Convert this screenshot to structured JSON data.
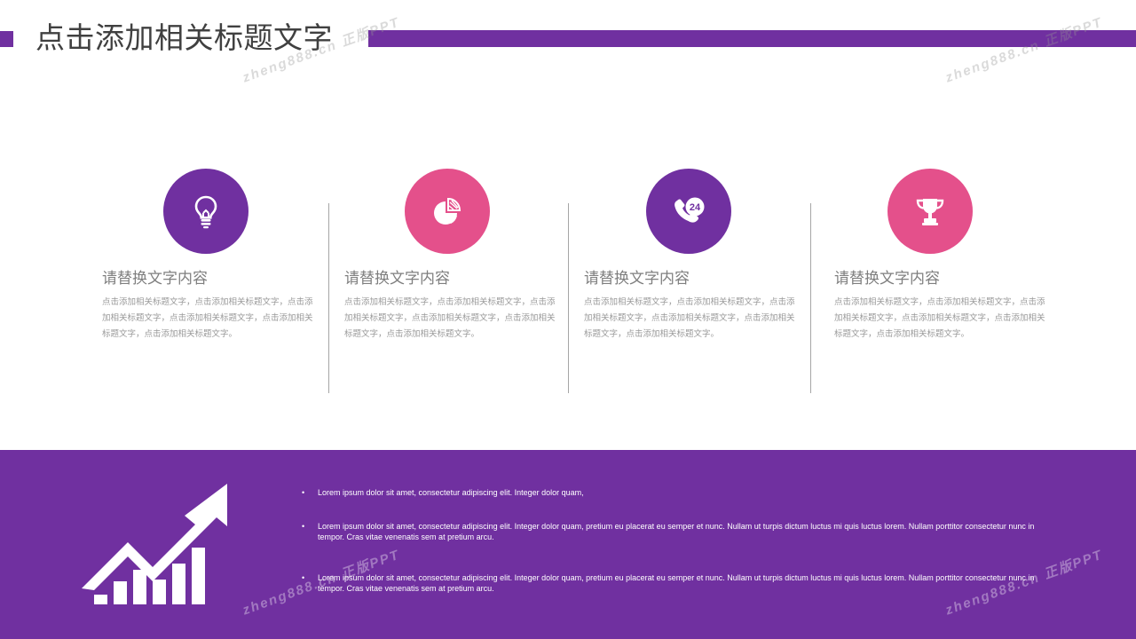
{
  "slide": {
    "title": "点击添加相关标题文字"
  },
  "cards": [
    {
      "icon": "lightbulb-icon",
      "color": "#7030a0",
      "title": "请替换文字内容",
      "desc": "点击添加相关标题文字，点击添加相关标题文字，点击添加相关标题文字，点击添加相关标题文字，点击添加相关标题文字，点击添加相关标题文字。"
    },
    {
      "icon": "pie-chart-icon",
      "color": "#e4508b",
      "title": "请替换文字内容",
      "desc": "点击添加相关标题文字，点击添加相关标题文字，点击添加相关标题文字，点击添加相关标题文字，点击添加相关标题文字，点击添加相关标题文字。"
    },
    {
      "icon": "phone-24-icon",
      "color": "#7030a0",
      "title": "请替换文字内容",
      "badge": "24",
      "desc": "点击添加相关标题文字，点击添加相关标题文字，点击添加相关标题文字，点击添加相关标题文字，点击添加相关标题文字，点击添加相关标题文字。"
    },
    {
      "icon": "trophy-icon",
      "color": "#e4508b",
      "title": "请替换文字内容",
      "desc": "点击添加相关标题文字，点击添加相关标题文字，点击添加相关标题文字，点击添加相关标题文字，点击添加相关标题文字，点击添加相关标题文字。"
    }
  ],
  "bottom": {
    "icon": "growth-chart-icon",
    "bullet_symbol": "•",
    "bullets": [
      "Lorem ipsum dolor sit amet, consectetur adipiscing elit. Integer dolor quam,",
      "Lorem ipsum dolor sit amet, consectetur adipiscing elit. Integer dolor quam, pretium eu placerat eu semper et nunc. Nullam ut turpis dictum luctus mi quis luctus lorem. Nullam porttitor consectetur nunc in tempor. Cras vitae venenatis sem at pretium arcu.",
      "Lorem ipsum dolor sit amet, consectetur adipiscing elit. Integer dolor quam, pretium eu placerat eu semper et nunc. Nullam ut turpis dictum luctus mi quis luctus lorem. Nullam porttitor consectetur nunc in tempor. Cras vitae venenatis sem at pretium arcu."
    ]
  },
  "watermark": "zheng888.cn 正版PPT",
  "colors": {
    "accent_purple": "#7030a0",
    "accent_pink": "#e4508b",
    "title_gray": "#404040",
    "text_gray": "#9a9a9a"
  }
}
